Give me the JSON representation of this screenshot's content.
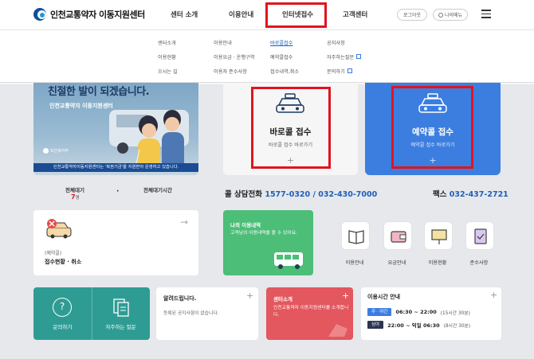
{
  "header": {
    "logo_text": "인천교통약자 이동지원센터",
    "nav": [
      "센터 소개",
      "이용안내",
      "인터넷접수",
      "고객센터"
    ],
    "login_label": "로그아웃",
    "mymenu_label": "나의메뉴"
  },
  "dropdown": {
    "col1": [
      "센터소개",
      "이용현황",
      "오시는 길"
    ],
    "col2": [
      "이용안내",
      "이용요금 · 운행구역",
      "이용자 준수사항"
    ],
    "col3": [
      "바로콜접수",
      "예약콜접수",
      "접수내역,취소"
    ],
    "col4": [
      "공지사항",
      "자주하는질문",
      "문의하기"
    ]
  },
  "banner": {
    "title": "친절한 발이 되겠습니다.",
    "subtitle": "인천교통약자 이동지원센터",
    "ministry": "보건복지부",
    "caption": "인천교통약자이동지원센터는 '복권기금'을 지원받아 운영하고 있습니다."
  },
  "quick": {
    "baro_title": "바로콜 접수",
    "baro_sub": "바로콜 접수 바로가기",
    "res_title": "예약콜 접수",
    "res_sub": "예약콜 접수 바로가기",
    "plus": "+"
  },
  "stats": {
    "wait_label": "전체대기",
    "wait_value": "7",
    "wait_unit": "명",
    "wait_time_label": "전체대기시간",
    "dot": "·"
  },
  "contact": {
    "call_label": "콜 상담전화",
    "call_num1": "1577-0320",
    "call_sep": " / ",
    "call_num2": "032-430-7000",
    "fax_label": "팩스",
    "fax_num": "032-437-2721"
  },
  "apply_card": {
    "sub": "(예약콜)",
    "title": "접수현황 · 취소",
    "arrow": "→"
  },
  "mine_card": {
    "title": "나의 이용내역",
    "desc": "고객님의 이용내역을 볼 수 있어요."
  },
  "quick_icons": [
    "이용안내",
    "요금안내",
    "이용현황",
    "준수사항"
  ],
  "faq": {
    "ask_label": "문의하기",
    "faq_label": "자주하는 질문",
    "q_glyph": "?"
  },
  "notice": {
    "title": "알려드립니다.",
    "empty": "등록된 공지사항이 없습니다.",
    "plus": "+"
  },
  "intro": {
    "title": "센터소개",
    "desc": "인천교통약자 이동지원센터를 소개합니다.",
    "plus": "+"
  },
  "hours": {
    "title": "이용시간 안내",
    "plus": "+",
    "rows": [
      {
        "tag": "주 · 야간",
        "time": "06:30 ~ 22:00",
        "note": "(15시간 30분)"
      },
      {
        "tag": "심야",
        "time": "22:00 ~ 익일 06:30",
        "note": "(8시간 30분)"
      }
    ]
  }
}
